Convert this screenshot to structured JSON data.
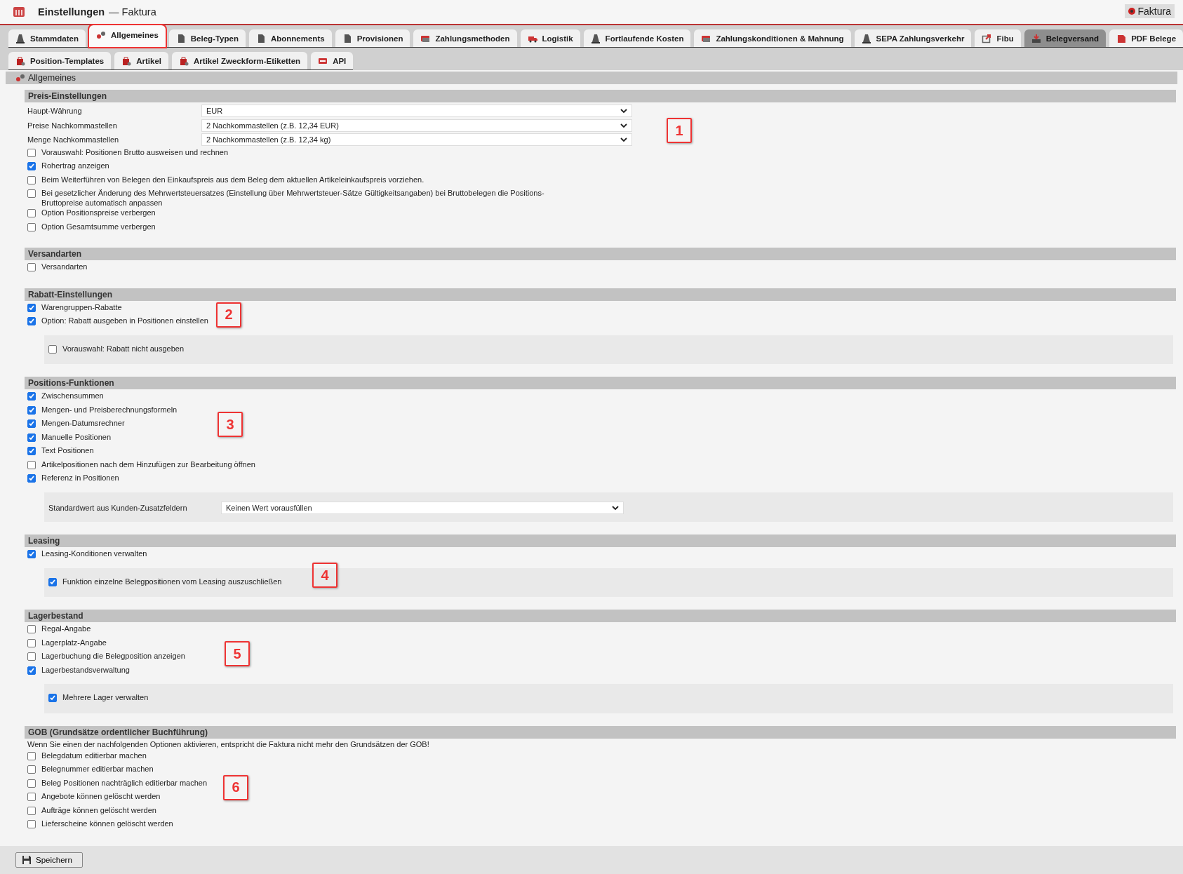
{
  "window": {
    "title": "Einstellungen",
    "subtitle": "— Faktura",
    "badge": "Faktura"
  },
  "tabs": [
    {
      "label": "Stammdaten",
      "selected": false,
      "shaded": false
    },
    {
      "label": "Allgemeines",
      "selected": true,
      "shaded": false
    },
    {
      "label": "Beleg-Typen",
      "selected": false,
      "shaded": false
    },
    {
      "label": "Abonnements",
      "selected": false,
      "shaded": false
    },
    {
      "label": "Provisionen",
      "selected": false,
      "shaded": false
    },
    {
      "label": "Zahlungsmethoden",
      "selected": false,
      "shaded": false
    },
    {
      "label": "Logistik",
      "selected": false,
      "shaded": false
    },
    {
      "label": "Fortlaufende Kosten",
      "selected": false,
      "shaded": false
    },
    {
      "label": "Zahlungskonditionen & Mahnung",
      "selected": false,
      "shaded": false
    },
    {
      "label": "SEPA Zahlungsverkehr",
      "selected": false,
      "shaded": false
    },
    {
      "label": "Fibu",
      "selected": false,
      "shaded": false
    },
    {
      "label": "Belegversand",
      "selected": false,
      "shaded": true
    },
    {
      "label": "PDF Belege",
      "selected": false,
      "shaded": false
    }
  ],
  "subtabs": [
    {
      "label": "Position-Templates",
      "selected": false
    },
    {
      "label": "Artikel",
      "selected": false
    },
    {
      "label": "Artikel Zweckform-Etiketten",
      "selected": false
    },
    {
      "label": "API",
      "selected": false
    }
  ],
  "panel_title": "Allgemeines",
  "sections": [
    {
      "title": "Preis-Einstellungen",
      "callout": "1",
      "items": [
        {
          "kind": "select",
          "label": "Haupt-Währung",
          "value": "EUR"
        },
        {
          "kind": "select",
          "label": "Preise Nachkommastellen",
          "value": "2 Nachkommastellen (z.B. 12,34 EUR)"
        },
        {
          "kind": "select",
          "label": "Menge Nachkommastellen",
          "value": "2 Nachkommastellen (z.B. 12,34 kg)"
        },
        {
          "kind": "checkbox",
          "label": "Vorauswahl: Positionen Brutto ausweisen und rechnen",
          "checked": false
        },
        {
          "kind": "checkbox",
          "label": "Rohertrag anzeigen",
          "checked": true
        },
        {
          "kind": "checkbox",
          "label": "Beim Weiterführen von Belegen den Einkaufspreis aus dem Beleg dem aktuellen Artikeleinkaufspreis vorziehen.",
          "checked": false
        },
        {
          "kind": "checkbox",
          "label": "Bei gesetzlicher Änderung des Mehrwertsteuersatzes (Einstellung über Mehrwertsteuer-Sätze Gültigkeitsangaben) bei Bruttobelegen die Positions-Bruttopreise automatisch anpassen",
          "checked": false
        },
        {
          "kind": "checkbox",
          "label": "Option Positionspreise verbergen",
          "checked": false
        },
        {
          "kind": "checkbox",
          "label": "Option Gesamtsumme verbergen",
          "checked": false
        }
      ]
    },
    {
      "title": "Versandarten",
      "items": [
        {
          "kind": "checkbox",
          "label": "Versandarten",
          "checked": false
        }
      ]
    },
    {
      "title": "Rabatt-Einstellungen",
      "callout": "2",
      "items": [
        {
          "kind": "checkbox",
          "label": "Warengruppen-Rabatte",
          "checked": true
        },
        {
          "kind": "checkbox",
          "label": "Option: Rabatt ausgeben in Positionen einstellen",
          "checked": true
        },
        {
          "kind": "subgroup",
          "items": [
            {
              "kind": "checkbox",
              "label": "Vorauswahl: Rabatt nicht ausgeben",
              "checked": false
            }
          ]
        }
      ]
    },
    {
      "title": "Positions-Funktionen",
      "callout": "3",
      "items": [
        {
          "kind": "checkbox",
          "label": "Zwischensummen",
          "checked": true
        },
        {
          "kind": "checkbox",
          "label": "Mengen- und Preisberechnungsformeln",
          "checked": true
        },
        {
          "kind": "checkbox",
          "label": "Mengen-Datumsrechner",
          "checked": true
        },
        {
          "kind": "checkbox",
          "label": "Manuelle Positionen",
          "checked": true
        },
        {
          "kind": "checkbox",
          "label": "Text Positionen",
          "checked": true
        },
        {
          "kind": "checkbox",
          "label": "Artikelpositionen nach dem Hinzufügen zur Bearbeitung öffnen",
          "checked": false
        },
        {
          "kind": "checkbox",
          "label": "Referenz in Positionen",
          "checked": true
        },
        {
          "kind": "subgroup",
          "items": [
            {
              "kind": "select",
              "label": "Standardwert aus Kunden-Zusatzfeldern",
              "value": "Keinen Wert vorausfüllen"
            }
          ]
        }
      ]
    },
    {
      "title": "Leasing",
      "callout": "4",
      "items": [
        {
          "kind": "checkbox",
          "label": "Leasing-Konditionen verwalten",
          "checked": true
        },
        {
          "kind": "subgroup",
          "items": [
            {
              "kind": "checkbox",
              "label": "Funktion einzelne Belegpositionen vom Leasing auszuschließen",
              "checked": true
            }
          ]
        }
      ]
    },
    {
      "title": "Lagerbestand",
      "callout": "5",
      "items": [
        {
          "kind": "checkbox",
          "label": "Regal-Angabe",
          "checked": false
        },
        {
          "kind": "checkbox",
          "label": "Lagerplatz-Angabe",
          "checked": false
        },
        {
          "kind": "checkbox",
          "label": "Lagerbuchung die Belegposition anzeigen",
          "checked": false
        },
        {
          "kind": "checkbox",
          "label": "Lagerbestandsverwaltung",
          "checked": true
        },
        {
          "kind": "subgroup",
          "items": [
            {
              "kind": "checkbox",
              "label": "Mehrere Lager verwalten",
              "checked": true
            }
          ]
        }
      ]
    },
    {
      "title": "GOB (Grundsätze ordentlicher Buchführung)",
      "callout": "6",
      "items": [
        {
          "kind": "note",
          "text": "Wenn Sie einen der nachfolgenden Optionen aktivieren, entspricht die Faktura nicht mehr den Grundsätzen der GOB!"
        },
        {
          "kind": "checkbox",
          "label": "Belegdatum editierbar machen",
          "checked": false
        },
        {
          "kind": "checkbox",
          "label": "Belegnummer editierbar machen",
          "checked": false
        },
        {
          "kind": "checkbox",
          "label": "Beleg Positionen nachträglich editierbar machen",
          "checked": false
        },
        {
          "kind": "checkbox",
          "label": "Angebote können gelöscht werden",
          "checked": false
        },
        {
          "kind": "checkbox",
          "label": "Aufträge können gelöscht werden",
          "checked": false
        },
        {
          "kind": "checkbox",
          "label": "Lieferscheine können gelöscht werden",
          "checked": false
        }
      ]
    }
  ],
  "save_button": "Speichern"
}
